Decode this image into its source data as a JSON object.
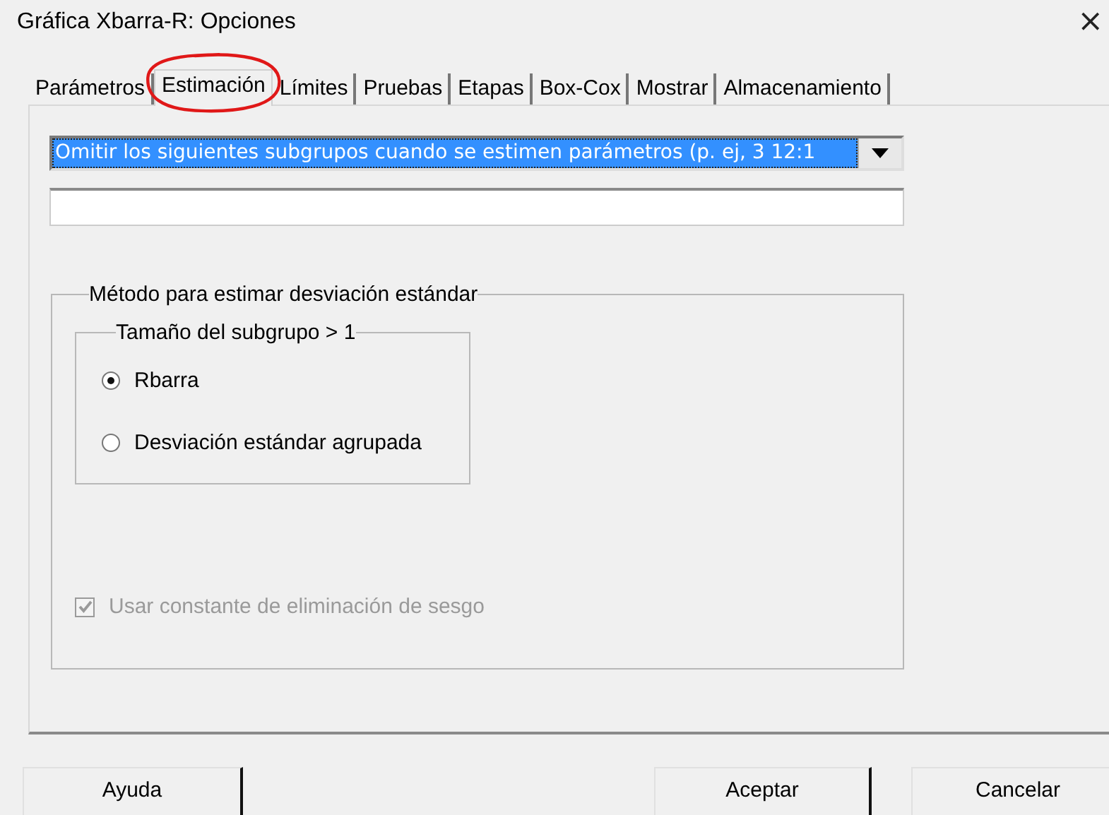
{
  "window": {
    "title": "Gráfica Xbarra-R: Opciones",
    "close": "×"
  },
  "tabs": [
    {
      "label": "Parámetros",
      "selected": false,
      "annotated": false
    },
    {
      "label": "Estimación",
      "selected": true,
      "annotated": true
    },
    {
      "label": "Límites",
      "selected": false,
      "annotated": false
    },
    {
      "label": "Pruebas",
      "selected": false,
      "annotated": false
    },
    {
      "label": "Etapas",
      "selected": false,
      "annotated": false
    },
    {
      "label": "Box-Cox",
      "selected": false,
      "annotated": false
    },
    {
      "label": "Mostrar",
      "selected": false,
      "annotated": false
    },
    {
      "label": "Almacenamiento",
      "selected": false,
      "annotated": false
    }
  ],
  "dropdown": {
    "value": "Omitir los siguientes subgrupos cuando se estimen parámetros (p. ej, 3 12:1",
    "highlighted": true
  },
  "method_group": {
    "title": "Método para estimar desviación estándar",
    "subgroup_box": {
      "title": "Tamaño del subgrupo > 1",
      "options": [
        {
          "label": "Rbarra",
          "selected": true
        },
        {
          "label": "Desviación estándar agrupada",
          "selected": false
        }
      ]
    },
    "bias_checkbox": {
      "label": "Usar constante de eliminación de sesgo",
      "checked": true,
      "disabled": true
    }
  },
  "buttons": [
    {
      "label": "Ayuda"
    },
    {
      "label": "Aceptar"
    },
    {
      "label": "Cancelar"
    }
  ]
}
